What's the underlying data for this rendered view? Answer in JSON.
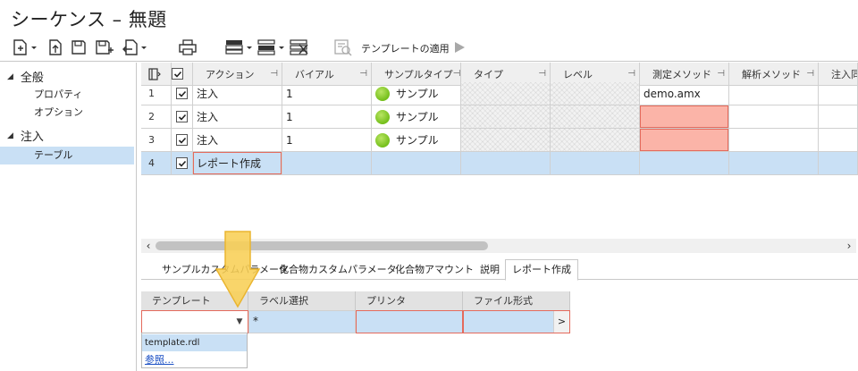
{
  "window": {
    "title": "シーケンス – 無題"
  },
  "toolbar": {
    "template_label": "テンプレートの適用",
    "icons": [
      "new-icon",
      "open-icon",
      "save-icon",
      "save-as-icon",
      "import-icon",
      "print-icon",
      "insert-row-icon",
      "append-row-icon",
      "delete-row-icon",
      "template-icon",
      "run-icon"
    ]
  },
  "sidebar": {
    "categories": [
      {
        "label": "全般",
        "items": [
          {
            "label": "プロパティ"
          },
          {
            "label": "オプション"
          }
        ]
      },
      {
        "label": "注入",
        "items": [
          {
            "label": "テーブル"
          }
        ]
      }
    ]
  },
  "sequence_table": {
    "columns": [
      "アクション",
      "バイアル",
      "サンプルタイプ",
      "タイプ",
      "レベル",
      "測定メソッド",
      "解析メソッド",
      "注入同"
    ],
    "rows": [
      {
        "num": "1",
        "checked": true,
        "action": "注入",
        "vial": "1",
        "sample_type": "サンプル",
        "type": "",
        "level": "",
        "method": "demo.amx",
        "analysis": ""
      },
      {
        "num": "2",
        "checked": true,
        "action": "注入",
        "vial": "1",
        "sample_type": "サンプル",
        "type": "",
        "level": "",
        "method": "",
        "analysis": ""
      },
      {
        "num": "3",
        "checked": true,
        "action": "注入",
        "vial": "1",
        "sample_type": "サンプル",
        "type": "",
        "level": "",
        "method": "",
        "analysis": ""
      },
      {
        "num": "4",
        "checked": true,
        "action": "レポート作成",
        "vial": "",
        "sample_type": "",
        "type": "",
        "level": "",
        "method": "",
        "analysis": ""
      }
    ]
  },
  "tabs": [
    "サンプルカスタムパラメータ",
    "化合物カスタムパラメータ",
    "化合物アマウント",
    "説明",
    "レポート作成"
  ],
  "tabs_active": "レポート作成",
  "report_grid": {
    "headers": [
      "テンプレート",
      "ラベル選択",
      "プリンタ",
      "ファイル形式"
    ],
    "values": [
      "",
      "*",
      "",
      ""
    ],
    "more_button": ">"
  },
  "dropdown": {
    "options": [
      "template.rdl",
      "参照..."
    ],
    "highlighted": "template.rdl"
  },
  "colors": {
    "selection": "#c9e0f5",
    "error": "#fbb4a8",
    "status_ok": "#74bf1a",
    "callout": "#f8cf55"
  }
}
